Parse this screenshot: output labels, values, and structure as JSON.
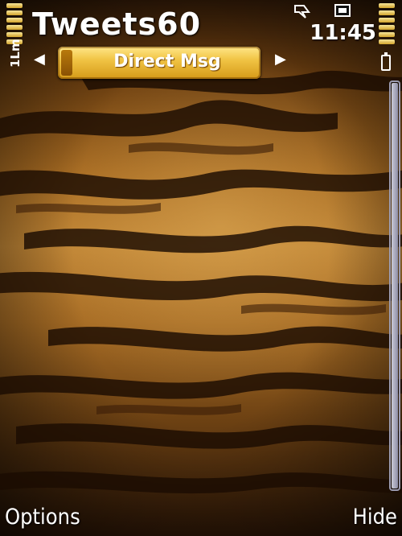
{
  "app": {
    "title": "Tweets60"
  },
  "status": {
    "time": "11:45",
    "signal_label": "1Lm"
  },
  "tabs": {
    "current": "Direct Msg",
    "prev_arrow": "◀",
    "next_arrow": "▶"
  },
  "softkeys": {
    "left": "Options",
    "right": "Hide"
  },
  "colors": {
    "accent": "#f1c445",
    "text": "#ffffff",
    "fur_dark": "#2a1606"
  }
}
